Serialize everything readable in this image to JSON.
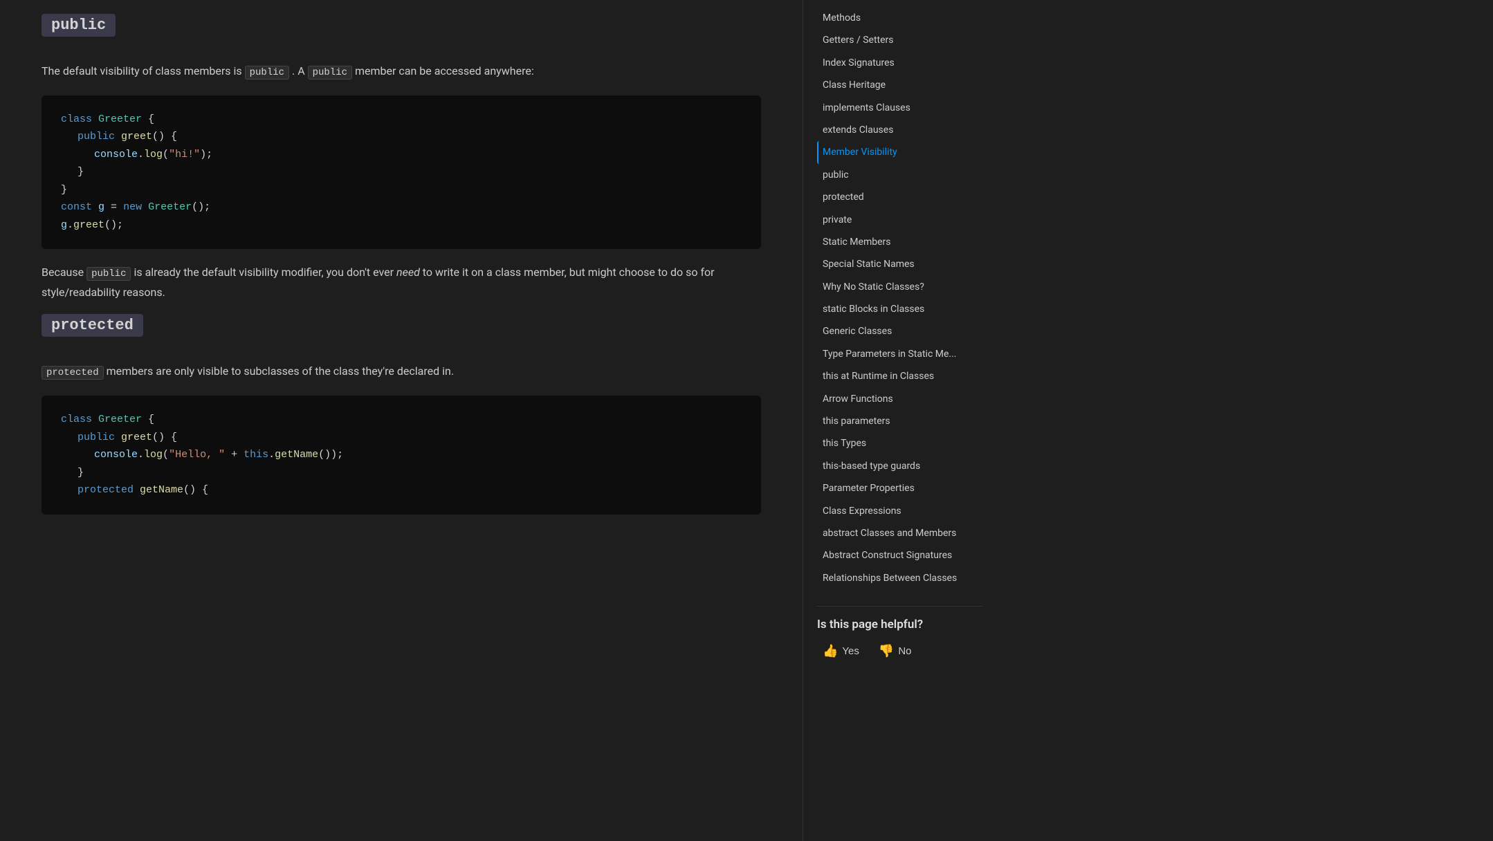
{
  "heading_public": "public",
  "heading_protected": "protected",
  "paragraph1": "The default visibility of class members is",
  "paragraph1_code1": "public",
  "paragraph1_mid": ". A",
  "paragraph1_code2": "public",
  "paragraph1_end": "member can be accessed anywhere:",
  "paragraph2_start": "Because",
  "paragraph2_code": "public",
  "paragraph2_rest": "is already the default visibility modifier, you don't ever",
  "paragraph2_em": "need",
  "paragraph2_end": "to write it on a class member, but might choose to do so for style/readability reasons.",
  "paragraph3_code": "protected",
  "paragraph3_rest": "members are only visible to subclasses of the class they're declared in.",
  "helpful_title": "Is this page helpful?",
  "yes_label": "Yes",
  "no_label": "No",
  "sidebar": {
    "items": [
      {
        "label": "Methods",
        "active": false
      },
      {
        "label": "Getters / Setters",
        "active": false
      },
      {
        "label": "Index Signatures",
        "active": false
      },
      {
        "label": "Class Heritage",
        "active": false
      },
      {
        "label": "implements Clauses",
        "active": false
      },
      {
        "label": "extends Clauses",
        "active": false
      },
      {
        "label": "Member Visibility",
        "active": true
      },
      {
        "label": "public",
        "active": false
      },
      {
        "label": "protected",
        "active": false
      },
      {
        "label": "private",
        "active": false
      },
      {
        "label": "Static Members",
        "active": false
      },
      {
        "label": "Special Static Names",
        "active": false
      },
      {
        "label": "Why No Static Classes?",
        "active": false
      },
      {
        "label": "static Blocks in Classes",
        "active": false
      },
      {
        "label": "Generic Classes",
        "active": false
      },
      {
        "label": "Type Parameters in Static Me...",
        "active": false
      },
      {
        "label": "this at Runtime in Classes",
        "active": false
      },
      {
        "label": "Arrow Functions",
        "active": false
      },
      {
        "label": "this parameters",
        "active": false
      },
      {
        "label": "this Types",
        "active": false
      },
      {
        "label": "this-based type guards",
        "active": false
      },
      {
        "label": "Parameter Properties",
        "active": false
      },
      {
        "label": "Class Expressions",
        "active": false
      },
      {
        "label": "abstract Classes and Members",
        "active": false
      },
      {
        "label": "Abstract Construct Signatures",
        "active": false
      },
      {
        "label": "Relationships Between Classes",
        "active": false
      }
    ]
  }
}
